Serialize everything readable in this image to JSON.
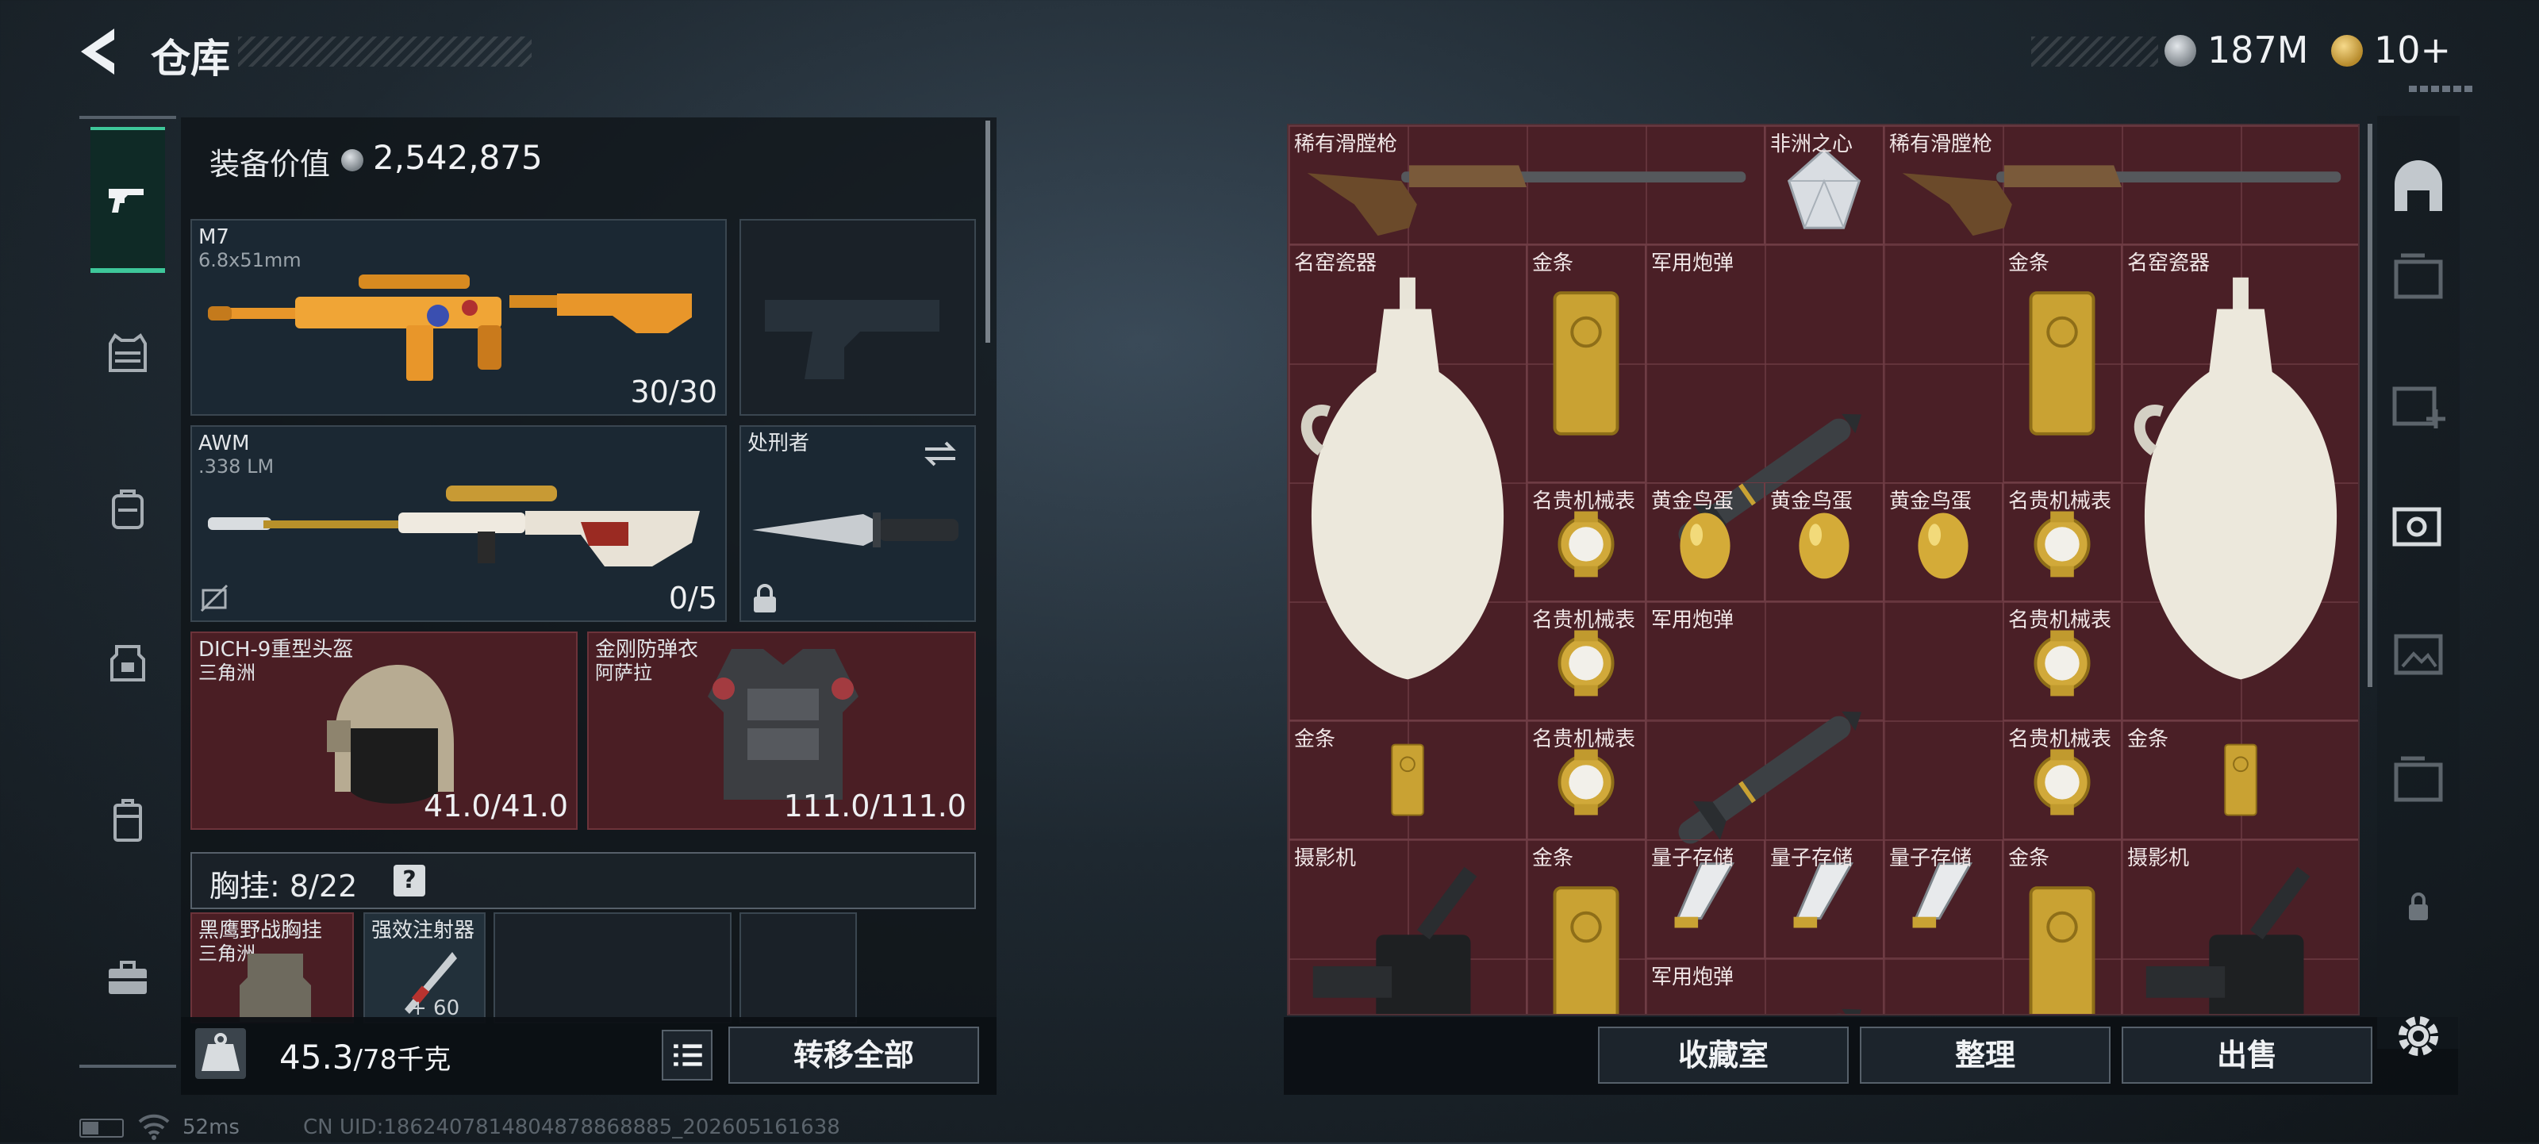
{
  "header": {
    "title": "仓库",
    "currency_1": "187M",
    "currency_2": "10+"
  },
  "left_nav": [
    "weapons",
    "armor",
    "backpack",
    "chest-rig",
    "case",
    "toolbox"
  ],
  "loadout": {
    "value_label": "装备价值",
    "value": "2,542,875",
    "primary": {
      "name": "M7",
      "caliber": "6.8x51mm",
      "ammo": "30/30"
    },
    "sniper": {
      "name": "AWM",
      "caliber": ".338 LM",
      "ammo": "0/5"
    },
    "melee": {
      "name": "处刑者"
    },
    "helmet": {
      "name": "DICH-9重型头盔",
      "faction": "三角洲",
      "durability": "41.0/41.0"
    },
    "armor": {
      "name": "金刚防弹衣",
      "faction": "阿萨拉",
      "durability": "111.0/111.0"
    },
    "chest_rig": {
      "label": "胸挂:",
      "count": "8/22",
      "help": "?"
    },
    "rig_item": {
      "name": "黑鹰野战胸挂",
      "faction": "三角洲"
    },
    "injector": {
      "name": "强效注射器",
      "count": "+ 60"
    }
  },
  "bottom_left": {
    "weight": "45.3",
    "weight_cap": "/78千克",
    "transfer_all": "转移全部"
  },
  "status": {
    "ping": "52ms",
    "uid": "CN UID:1862407814804878868885_202605161638"
  },
  "grid_items": [
    {
      "label": "稀有滑膛枪",
      "kind": "musket"
    },
    {
      "label": "非洲之心",
      "kind": "diamond"
    },
    {
      "label": "稀有滑膛枪",
      "kind": "musket"
    },
    {
      "label": "名窑瓷器",
      "kind": "vase"
    },
    {
      "label": "金条",
      "kind": "goldbar"
    },
    {
      "label": "军用炮弹",
      "kind": "missile"
    },
    {
      "label": "金条",
      "kind": "goldbar"
    },
    {
      "label": "名窑瓷器",
      "kind": "vase"
    },
    {
      "label": "名贵机械表",
      "kind": "watch"
    },
    {
      "label": "黄金鸟蛋",
      "kind": "egg"
    },
    {
      "label": "黄金鸟蛋",
      "kind": "egg"
    },
    {
      "label": "黄金鸟蛋",
      "kind": "egg"
    },
    {
      "label": "名贵机械表",
      "kind": "watch"
    },
    {
      "label": "名贵机械表",
      "kind": "watch"
    },
    {
      "label": "军用炮弹",
      "kind": "missile"
    },
    {
      "label": "名贵机械表",
      "kind": "watch"
    },
    {
      "label": "金条",
      "kind": "goldbar"
    },
    {
      "label": "名贵机械表",
      "kind": "watch"
    },
    {
      "label": "名贵机械表",
      "kind": "watch"
    },
    {
      "label": "金条",
      "kind": "goldbar"
    },
    {
      "label": "摄影机",
      "kind": "camera"
    },
    {
      "label": "金条",
      "kind": "goldbar"
    },
    {
      "label": "量子存储",
      "kind": "chip"
    },
    {
      "label": "量子存储",
      "kind": "chip"
    },
    {
      "label": "量子存储",
      "kind": "chip"
    },
    {
      "label": "金条",
      "kind": "goldbar"
    },
    {
      "label": "摄影机",
      "kind": "camera"
    },
    {
      "label": "军用炮弹",
      "kind": "missile"
    }
  ],
  "bottom_right": {
    "collection": "收藏室",
    "sort": "整理",
    "sell": "出售"
  },
  "colors": {
    "accent": "#3ec79a",
    "slot_red": "#4a1e24",
    "grid_bg": "#4a1f26"
  }
}
